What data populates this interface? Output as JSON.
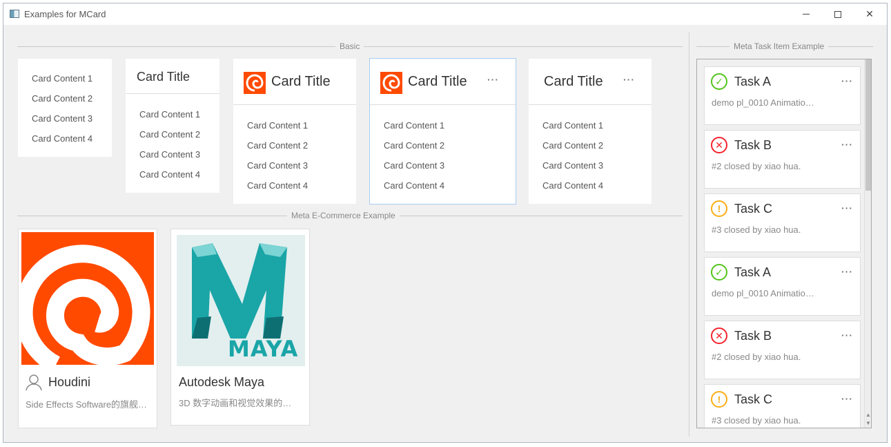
{
  "window": {
    "title": "Examples for MCard"
  },
  "sections": {
    "basic": "Basic",
    "ecommerce": "Meta E-Commerce Example",
    "task": "Meta Task Item Example"
  },
  "basic_cards": {
    "card_title": "Card Title",
    "more": "···",
    "contents": [
      "Card Content 1",
      "Card Content 2",
      "Card Content 3",
      "Card Content 4"
    ]
  },
  "products": [
    {
      "name": "Houdini",
      "desc": "Side Effects Software的旗舰…"
    },
    {
      "name": "Autodesk Maya",
      "desc": "3D 数字动画和视觉效果的…",
      "logo_text": "MAYA"
    }
  ],
  "tasks": [
    {
      "title": "Task A",
      "sub": "demo pl_0010 Animatio…",
      "status": "ok"
    },
    {
      "title": "Task B",
      "sub": "#2 closed by xiao hua.",
      "status": "err"
    },
    {
      "title": "Task C",
      "sub": "#3 closed by xiao hua.",
      "status": "warn"
    },
    {
      "title": "Task A",
      "sub": "demo pl_0010 Animatio…",
      "status": "ok"
    },
    {
      "title": "Task B",
      "sub": "#2 closed by xiao hua.",
      "status": "err"
    },
    {
      "title": "Task C",
      "sub": "#3 closed by xiao hua.",
      "status": "warn"
    }
  ],
  "colors": {
    "houdini": "#ff4a00",
    "maya": "#1aa5a7",
    "accent_border": "#a5cdf2"
  },
  "icons": {
    "ok": "check-circle-icon",
    "err": "close-circle-icon",
    "warn": "exclamation-circle-icon",
    "user": "user-icon"
  }
}
